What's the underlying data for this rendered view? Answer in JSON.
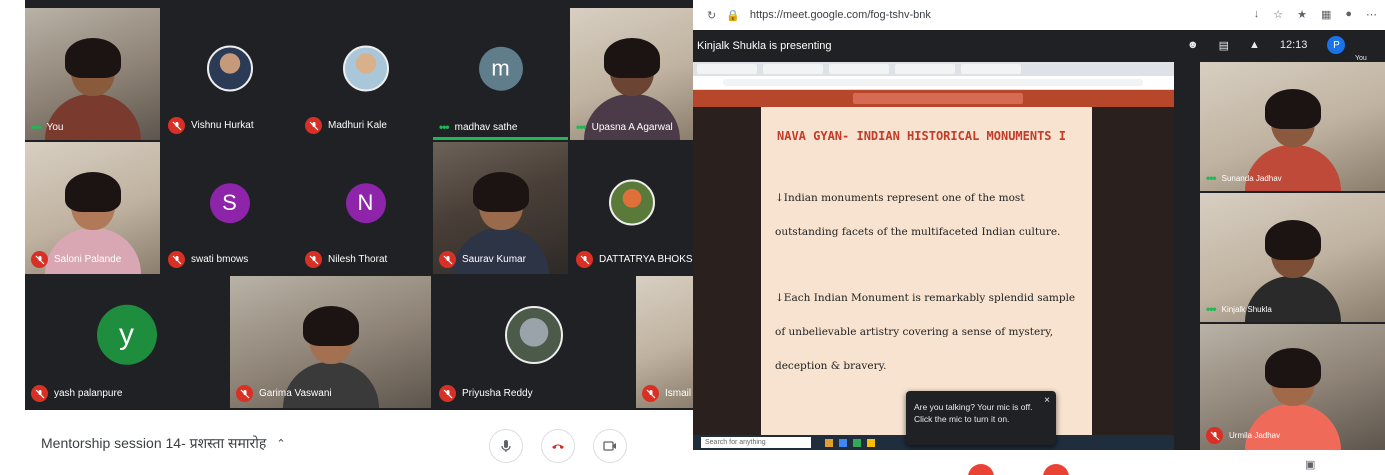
{
  "left_call": {
    "participants": [
      {
        "name": "You",
        "state": "speaking"
      },
      {
        "name": "Vishnu Hurkat",
        "state": "muted"
      },
      {
        "name": "Madhuri Kale",
        "state": "muted"
      },
      {
        "name": "madhav sathe",
        "state": "speaking",
        "initial": "m"
      },
      {
        "name": "Upasna A Agarwal",
        "state": "speaking"
      },
      {
        "name": "Saloni Palande",
        "state": "muted"
      },
      {
        "name": "swati bmows",
        "state": "muted",
        "initial": "S"
      },
      {
        "name": "Nilesh Thorat",
        "state": "muted",
        "initial": "N"
      },
      {
        "name": "Saurav Kumar",
        "state": "muted"
      },
      {
        "name": "DATTATRYA BHOKSE",
        "state": "muted"
      },
      {
        "name": "yash palanpure",
        "state": "muted",
        "initial": "y"
      },
      {
        "name": "Garima Vaswani",
        "state": "muted"
      },
      {
        "name": "Priyusha Reddy",
        "state": "muted"
      },
      {
        "name": "Ismail",
        "state": "muted"
      }
    ],
    "meeting_title": "Mentorship session 14- प्रशस्ता समारोह",
    "colors": {
      "tile_bg": "#3c4043",
      "speaking": "#1db954",
      "muted": "#d93025",
      "avatar_m": "#607d8b",
      "avatar_s": "#8e24aa",
      "avatar_n": "#8e24aa",
      "avatar_y": "#1e8e3e"
    },
    "controls": [
      "mic-icon",
      "hangup-icon",
      "camera-icon"
    ]
  },
  "right_call": {
    "browser_url": "https://meet.google.com/fog-tshv-bnk",
    "presenting_label": "Kinjalk Shukla is presenting",
    "time": "12:13",
    "you_label": "You",
    "you_initial": "P",
    "slide": {
      "title": "NAVA GYAN- INDIAN HISTORICAL MONUMENTS I",
      "para1": "↓Indian monuments represent one of the most outstanding facets of the multifaceted Indian culture.",
      "para2": "↓Each Indian Monument is remarkably splendid sample of unbelievable artistry covering a sense of mystery, deception & bravery."
    },
    "taskbar_search": "Search for anything",
    "toast": {
      "text": "Are you talking? Your mic is off. Click the mic to turn it on.",
      "close": "×"
    },
    "side_participants": [
      {
        "name": "Sunanda Jadhav",
        "state": "speaking"
      },
      {
        "name": "Kinjalk Shukla",
        "state": "speaking"
      },
      {
        "name": "Urmila Jadhav",
        "state": "muted"
      }
    ]
  }
}
